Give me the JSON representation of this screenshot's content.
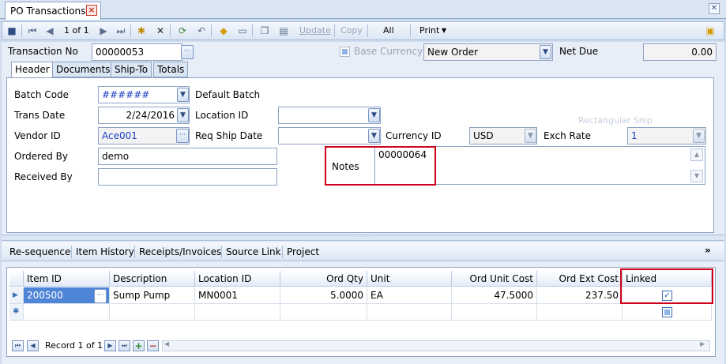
{
  "window": {
    "tab_title": "PO Transactions"
  },
  "toolbar": {
    "record_position": "1 of 1",
    "update_label": "Update",
    "copy_label": "Copy",
    "all_label": "All",
    "print_label": "Print"
  },
  "top": {
    "transaction_no_label": "Transaction No",
    "transaction_no_value": "00000053",
    "base_currency_label": "Base Currency",
    "status_value": "New Order",
    "net_due_label": "Net Due",
    "net_due_value": "0.00"
  },
  "tabs": [
    "Header",
    "Documents",
    "Ship-To",
    "Totals"
  ],
  "header": {
    "batch_code_label": "Batch Code",
    "batch_code_value": "######",
    "default_batch_label": "Default Batch",
    "trans_date_label": "Trans Date",
    "trans_date_value": "2/24/2016",
    "location_id_label": "Location ID",
    "location_id_value": "",
    "vendor_id_label": "Vendor ID",
    "vendor_id_value": "Ace001",
    "req_ship_date_label": "Req Ship Date",
    "req_ship_date_value": "",
    "currency_id_label": "Currency ID",
    "currency_id_value": "USD",
    "exch_rate_label": "Exch Rate",
    "exch_rate_value": "1",
    "ordered_by_label": "Ordered By",
    "ordered_by_value": "demo",
    "received_by_label": "Received By",
    "received_by_value": "",
    "notes_label": "Notes",
    "notes_value": "00000064",
    "ghost_text": "Rectangular Snip"
  },
  "links": [
    "Re-sequence",
    "Item History",
    "Receipts/Invoices",
    "Source Link",
    "Project"
  ],
  "grid": {
    "columns": [
      "Item ID",
      "Description",
      "Location ID",
      "Ord Qty",
      "Unit",
      "Ord Unit Cost",
      "Ord Ext Cost",
      "Linked"
    ],
    "rows": [
      {
        "item_id": "200500",
        "description": "Sump Pump",
        "location_id": "MN0001",
        "ord_qty": "5.0000",
        "unit": "EA",
        "ord_unit_cost": "47.5000",
        "ord_ext_cost": "237.50",
        "linked": true
      }
    ],
    "record_nav": "Record 1 of 1"
  }
}
